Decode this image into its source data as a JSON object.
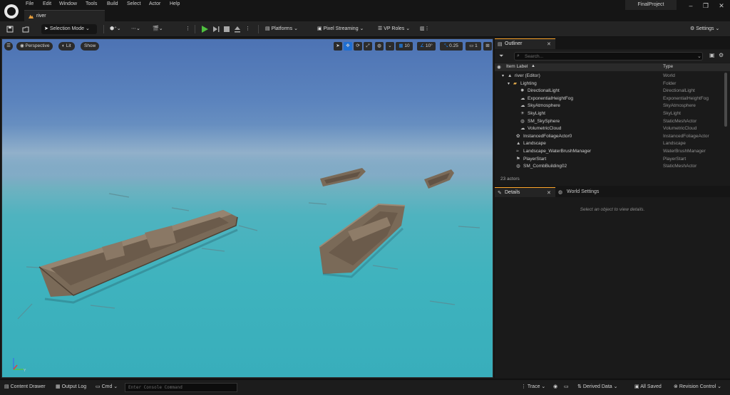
{
  "menu": [
    "File",
    "Edit",
    "Window",
    "Tools",
    "Build",
    "Select",
    "Actor",
    "Help"
  ],
  "document_tab": "river",
  "project_name": "FinalProject",
  "toolbar": {
    "selection_mode": "Selection Mode",
    "platforms": "Platforms",
    "pixel_streaming": "Pixel Streaming",
    "vp_roles": "VP Roles",
    "settings": "Settings"
  },
  "viewport": {
    "perspective": "Perspective",
    "lit": "Lit",
    "show": "Show",
    "grid_snap": "10",
    "rotation_snap": "10°",
    "scale_snap": "0.25",
    "camera_speed": "1"
  },
  "outliner": {
    "title": "Outliner",
    "search_placeholder": "Search...",
    "col_label": "Item Label",
    "col_type": "Type",
    "rows": [
      {
        "label": "river (Editor)",
        "type": "World"
      },
      {
        "label": "Lighting",
        "type": "Folder"
      },
      {
        "label": "DirectionalLight",
        "type": "DirectionalLight"
      },
      {
        "label": "ExponentialHeightFog",
        "type": "ExponentialHeightFog"
      },
      {
        "label": "SkyAtmosphere",
        "type": "SkyAtmosphere"
      },
      {
        "label": "SkyLight",
        "type": "SkyLight"
      },
      {
        "label": "SM_SkySphere",
        "type": "StaticMeshActor"
      },
      {
        "label": "VolumetricCloud",
        "type": "VolumetricCloud"
      },
      {
        "label": "InstancedFoliageActor0",
        "type": "InstancedFoliageActor"
      },
      {
        "label": "Landscape",
        "type": "Landscape"
      },
      {
        "label": "Landscape_WaterBrushManager",
        "type": "WaterBrushManager"
      },
      {
        "label": "PlayerStart",
        "type": "PlayerStart"
      },
      {
        "label": "SM_CombBuilding02",
        "type": "StaticMeshActor"
      }
    ],
    "actor_count": "23 actors"
  },
  "details": {
    "title": "Details",
    "world_settings": "World Settings",
    "empty_message": "Select an object to view details."
  },
  "statusbar": {
    "content_drawer": "Content Drawer",
    "output_log": "Output Log",
    "cmd": "Cmd",
    "console_placeholder": "Enter Console Command",
    "trace": "Trace",
    "derived_data": "Derived Data",
    "all_saved": "All Saved",
    "revision_control": "Revision Control"
  },
  "colors": {
    "accent": "#ffa629",
    "play": "#4fbf3f",
    "panel": "#1a1a1a",
    "toolbar": "#242424"
  }
}
